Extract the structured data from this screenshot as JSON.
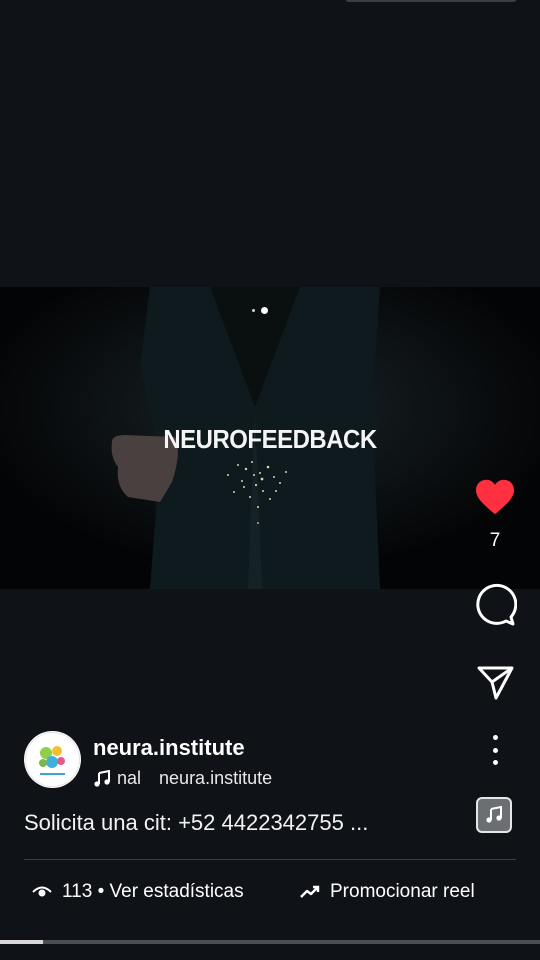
{
  "video": {
    "title": "NEUROFEEDBACK",
    "carousel_dots": 2,
    "active_dot": 1
  },
  "actions": {
    "like_count": "7",
    "like_color": "#ff3040"
  },
  "post": {
    "username": "neura.institute",
    "audio_name": "nal",
    "audio_owner": "neura.institute",
    "caption": "Solicita una cit: +52 4422342755 ..."
  },
  "footer": {
    "stats_label": "113 • Ver estadísticas",
    "promote_label": "Promocionar reel"
  },
  "playback": {
    "progress": 0.08
  }
}
